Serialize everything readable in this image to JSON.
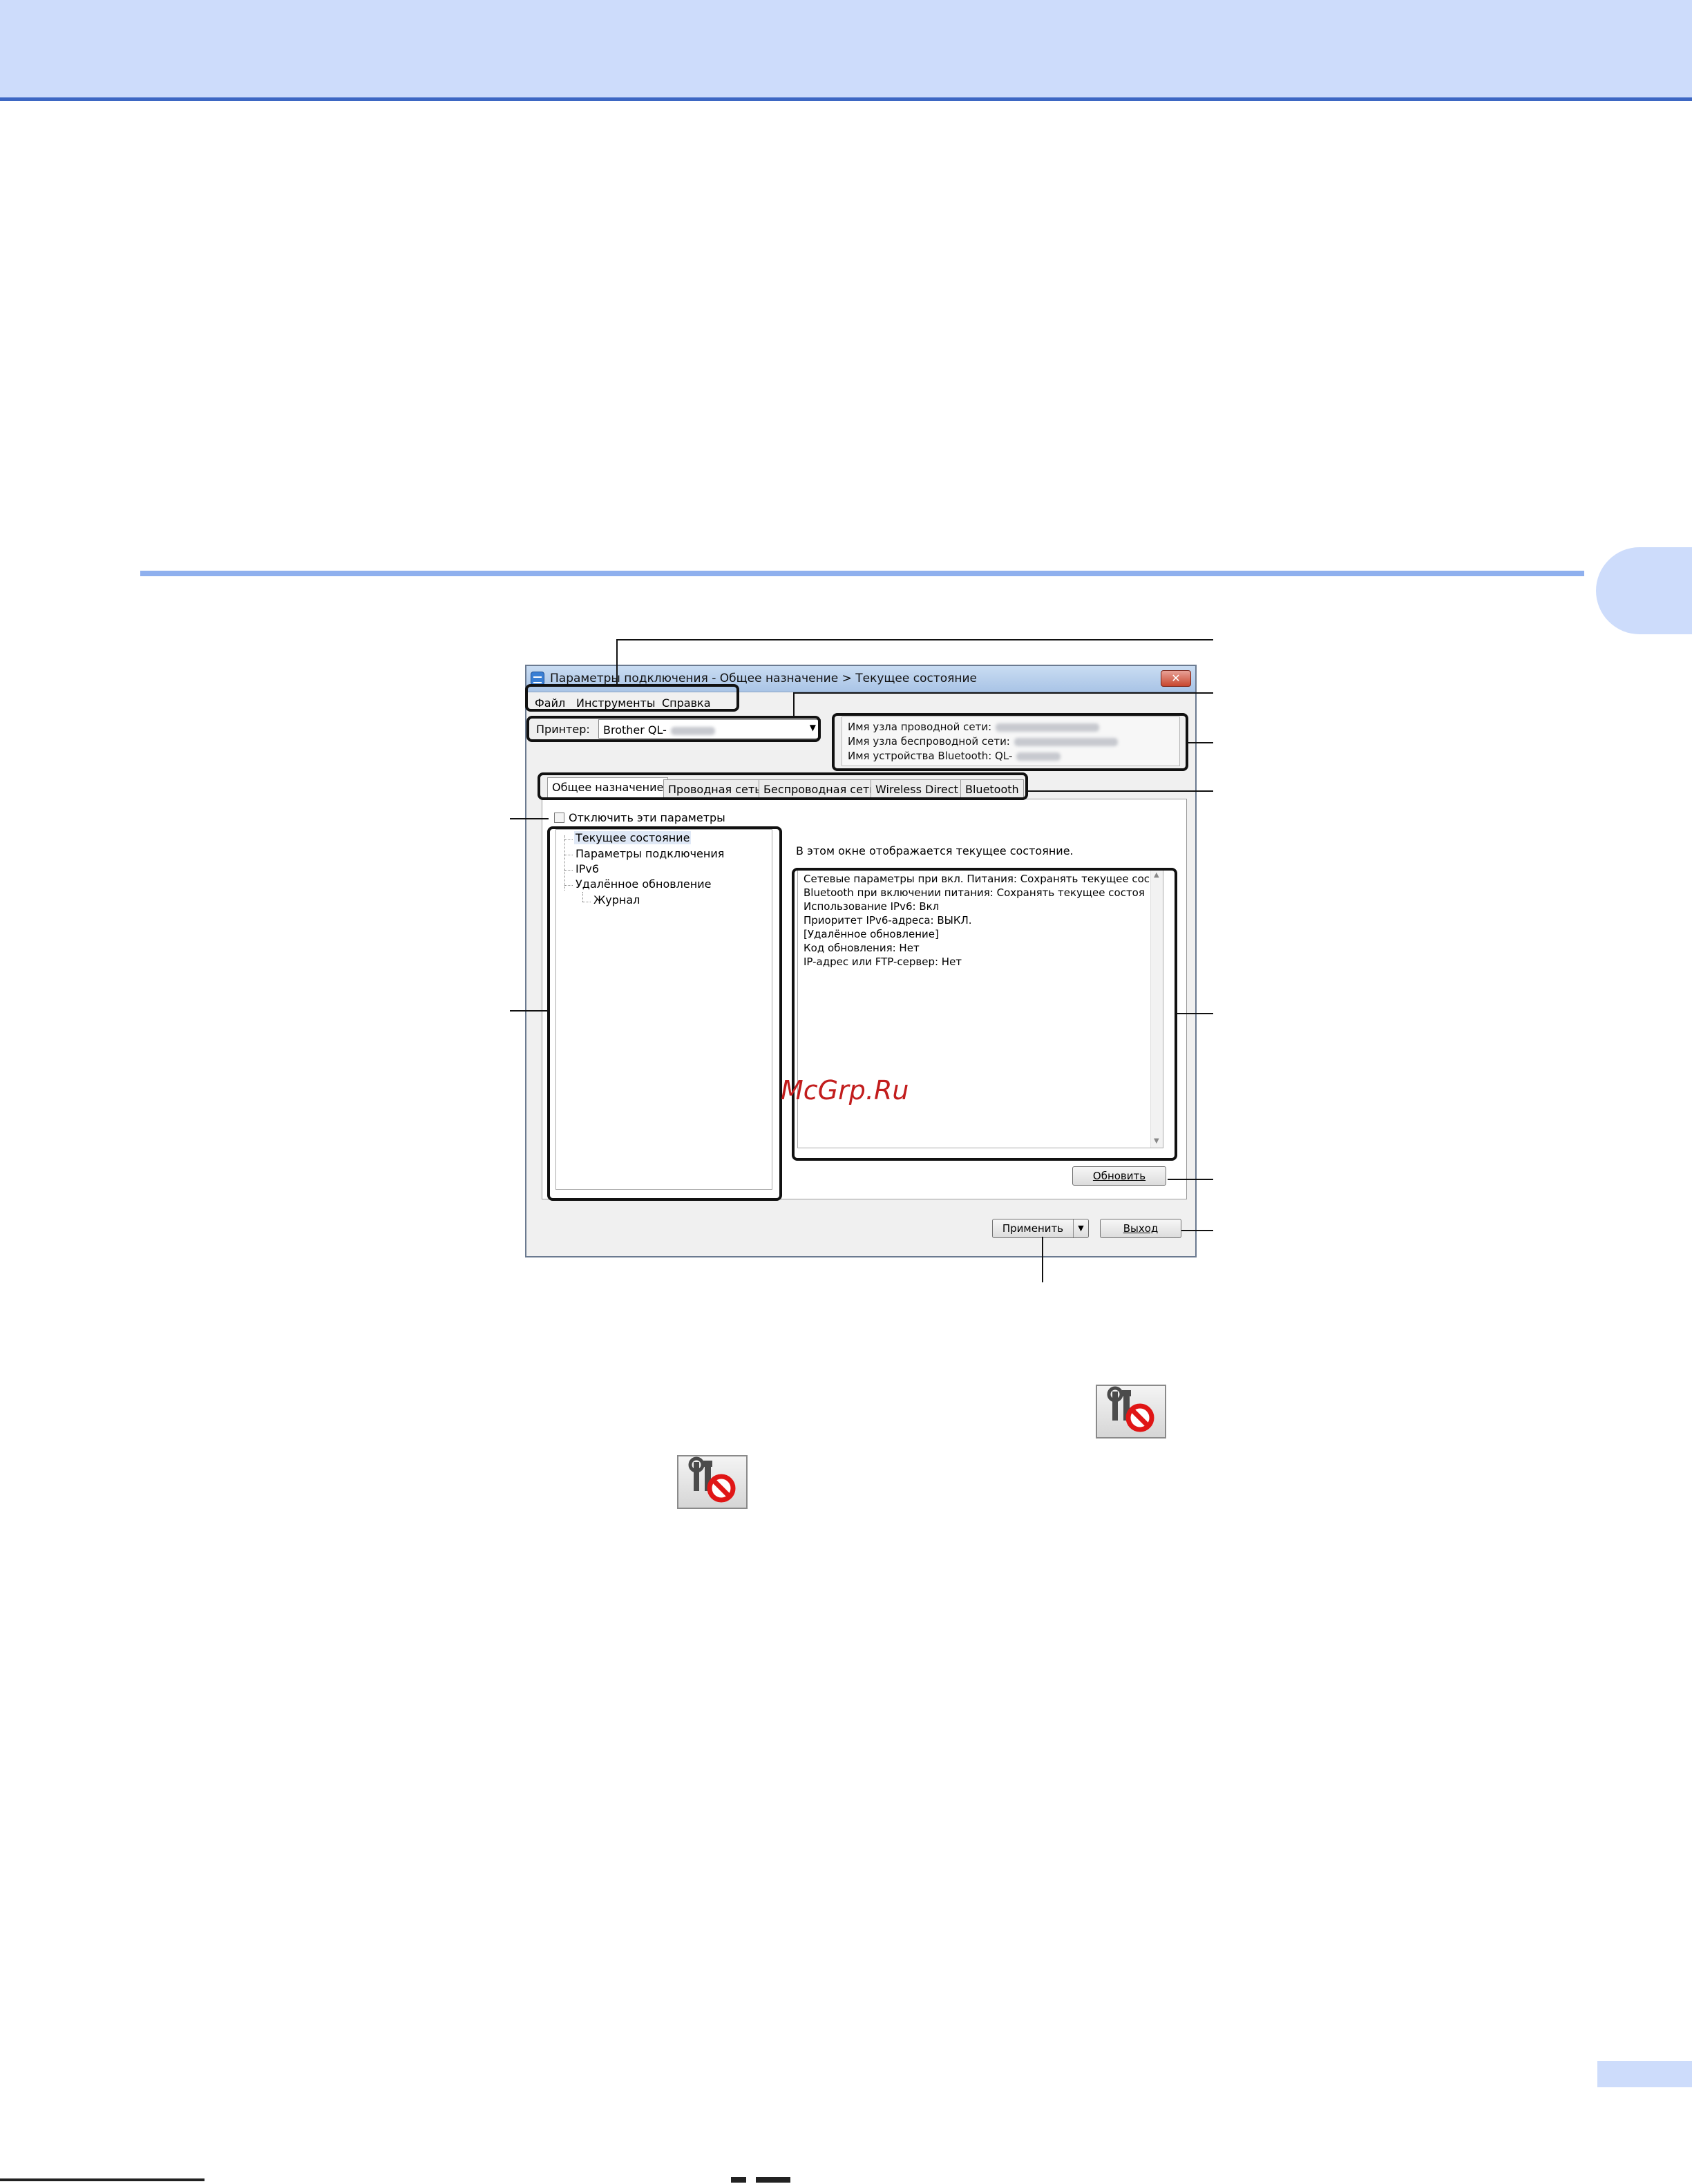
{
  "window": {
    "title": "Параметры подключения - Общее назначение > Текущее состояние",
    "close_label": "✕"
  },
  "menu": [
    {
      "label": "Файл"
    },
    {
      "label": "Инструменты"
    },
    {
      "label": "Справка"
    }
  ],
  "printer": {
    "label": "Принтер:",
    "value": "Brother QL-"
  },
  "info": {
    "wired_node": "Имя узла проводной сети:",
    "wireless_node": "Имя узла беспроводной сети:",
    "bluetooth_name": "Имя устройства Bluetooth: QL-"
  },
  "tabs": [
    {
      "label": "Общее назначение"
    },
    {
      "label": "Проводная сеть"
    },
    {
      "label": "Беспроводная сеть"
    },
    {
      "label": "Wireless Direct"
    },
    {
      "label": "Bluetooth"
    }
  ],
  "disable_checkbox_label": "Отключить эти параметры",
  "tree": [
    {
      "label": "Текущее состояние"
    },
    {
      "label": "Параметры подключения"
    },
    {
      "label": "IPv6"
    },
    {
      "label": "Удалённое обновление"
    },
    {
      "label": "Журнал"
    }
  ],
  "status": {
    "caption": "В этом окне отображается текущее состояние.",
    "lines": [
      "Сетевые параметры при вкл. Питания: Сохранять текущее сос",
      "Bluetooth при включении питания: Сохранять текущее состоя",
      "Использование IPv6: Вкл",
      "Приоритет IPv6-адреса: ВЫКЛ.",
      "[Удалённое обновление]",
      "Код обновления: Нет",
      "IP-адрес или FTP-сервер: Нет"
    ]
  },
  "buttons": {
    "refresh": "Обновить",
    "apply": "Применить",
    "exit": "Выход"
  },
  "watermark": "McGrp.Ru"
}
